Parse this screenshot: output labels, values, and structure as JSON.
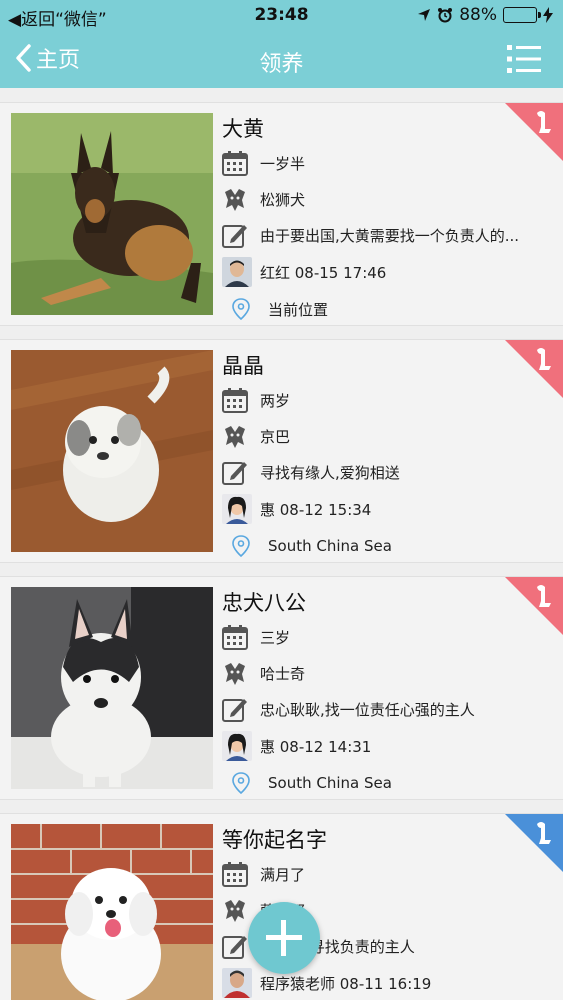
{
  "status_bar": {
    "back_app": "◀返回“微信”",
    "time": "23:48",
    "battery_text": "88%",
    "battery_level": 0.88
  },
  "navbar": {
    "back_label": "主页",
    "title": "领养"
  },
  "colors": {
    "theme": "#7ccfd6",
    "ribbon_female": "#f0707c",
    "ribbon_male": "#4a90d9"
  },
  "pets": [
    {
      "name": "大黄",
      "age": "一岁半",
      "breed": "松狮犬",
      "description": "由于要出国,大黄需要找一个负责人的...",
      "user": "红红 08-15 17:46",
      "location": "当前位置",
      "ribbon": "pink"
    },
    {
      "name": "晶晶",
      "age": "两岁",
      "breed": "京巴",
      "description": "寻找有缘人,爱狗相送",
      "user": "惠 08-12 15:34",
      "location": "South China Sea",
      "ribbon": "pink"
    },
    {
      "name": "忠犬八公",
      "age": "三岁",
      "breed": "哈士奇",
      "description": "忠心耿耿,找一位责任心强的主人",
      "user": "惠 08-12 14:31",
      "location": "South China Sea",
      "ribbon": "pink"
    },
    {
      "name": "等你起名字",
      "age": "满月了",
      "breed": "萨摩耶",
      "description": "满月了,寻找负责的主人",
      "user": "程序猿老师 08-11 16:19",
      "location": "",
      "ribbon": "blue"
    }
  ]
}
